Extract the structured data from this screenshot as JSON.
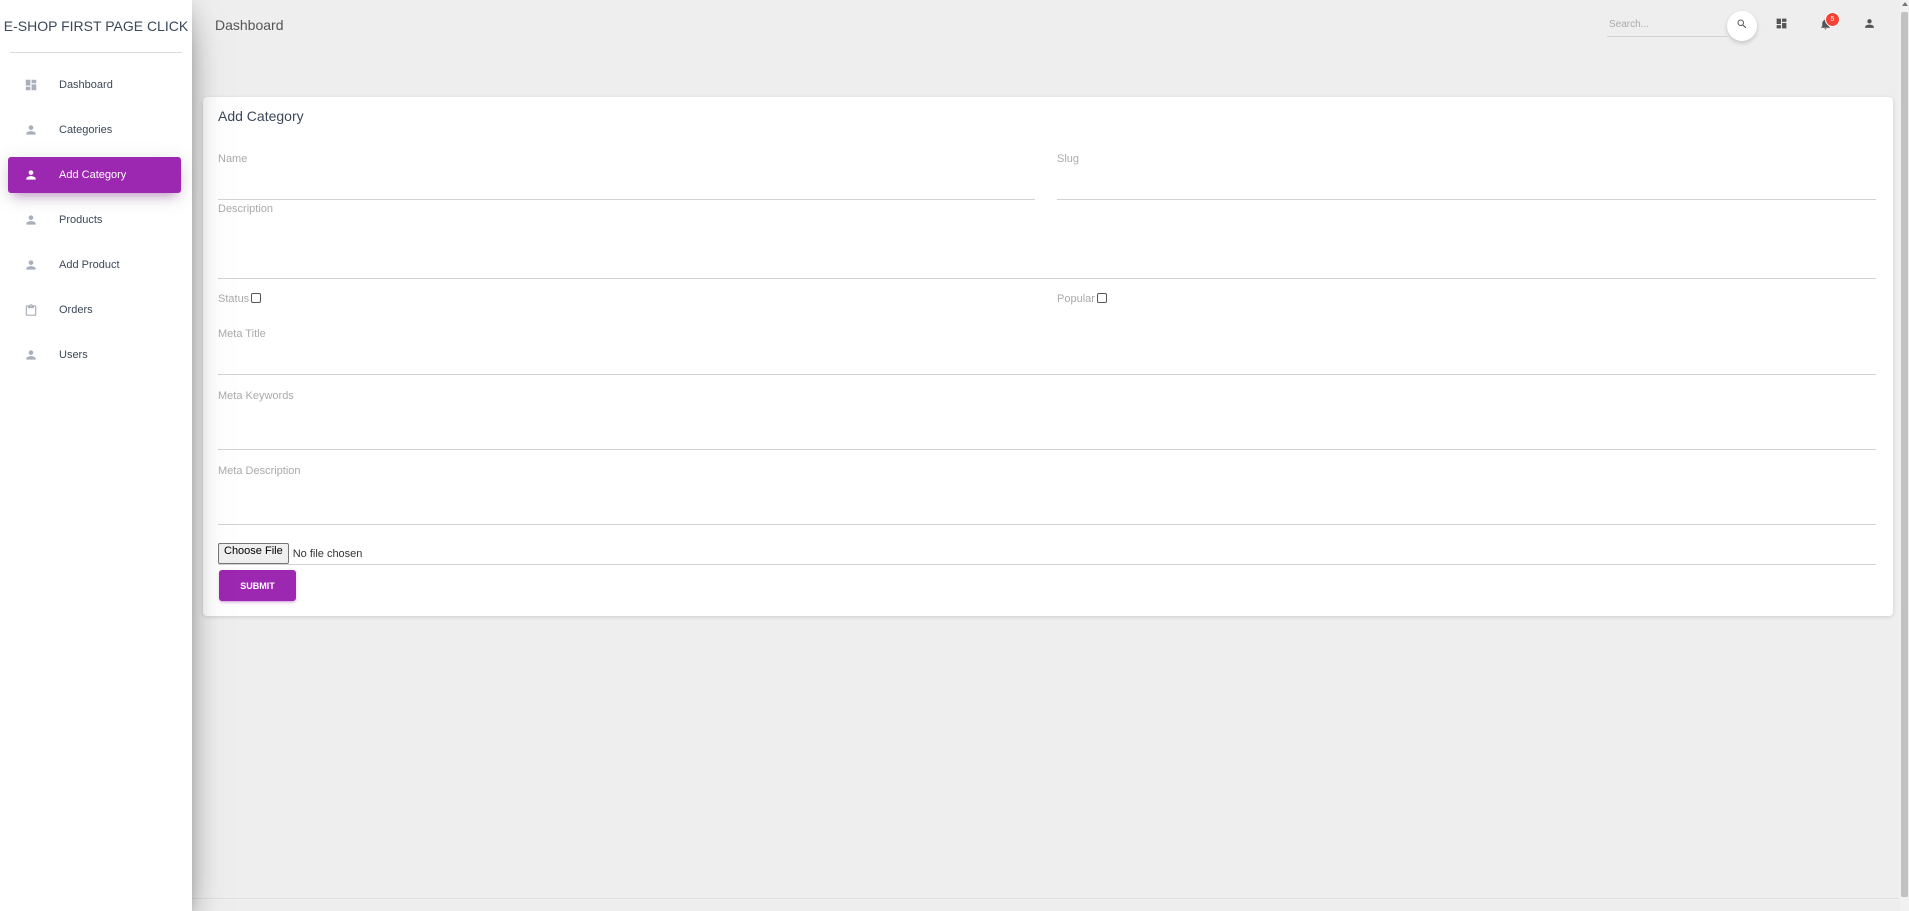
{
  "brand": {
    "title": "E-SHOP FIRST PAGE CLICK"
  },
  "sidebar": {
    "items": [
      {
        "label": "Dashboard",
        "icon": "dashboard-icon"
      },
      {
        "label": "Categories",
        "icon": "person-icon"
      },
      {
        "label": "Add Category",
        "icon": "person-icon",
        "active": true
      },
      {
        "label": "Products",
        "icon": "person-icon"
      },
      {
        "label": "Add Product",
        "icon": "person-icon"
      },
      {
        "label": "Orders",
        "icon": "clipboard-icon"
      },
      {
        "label": "Users",
        "icon": "person-icon"
      }
    ]
  },
  "header": {
    "title": "Dashboard",
    "search_placeholder": "Search...",
    "notification_count": "5"
  },
  "form": {
    "title": "Add Category",
    "name_label": "Name",
    "slug_label": "Slug",
    "description_label": "Description",
    "status_label": "Status",
    "popular_label": "Popular",
    "meta_title_label": "Meta Title",
    "meta_keywords_label": "Meta Keywords",
    "meta_description_label": "Meta Description",
    "file_button_label": "Choose File",
    "file_status": "No file chosen",
    "submit_label": "SUBMIT"
  },
  "colors": {
    "accent": "#9c27b0",
    "badge": "#f44336"
  }
}
